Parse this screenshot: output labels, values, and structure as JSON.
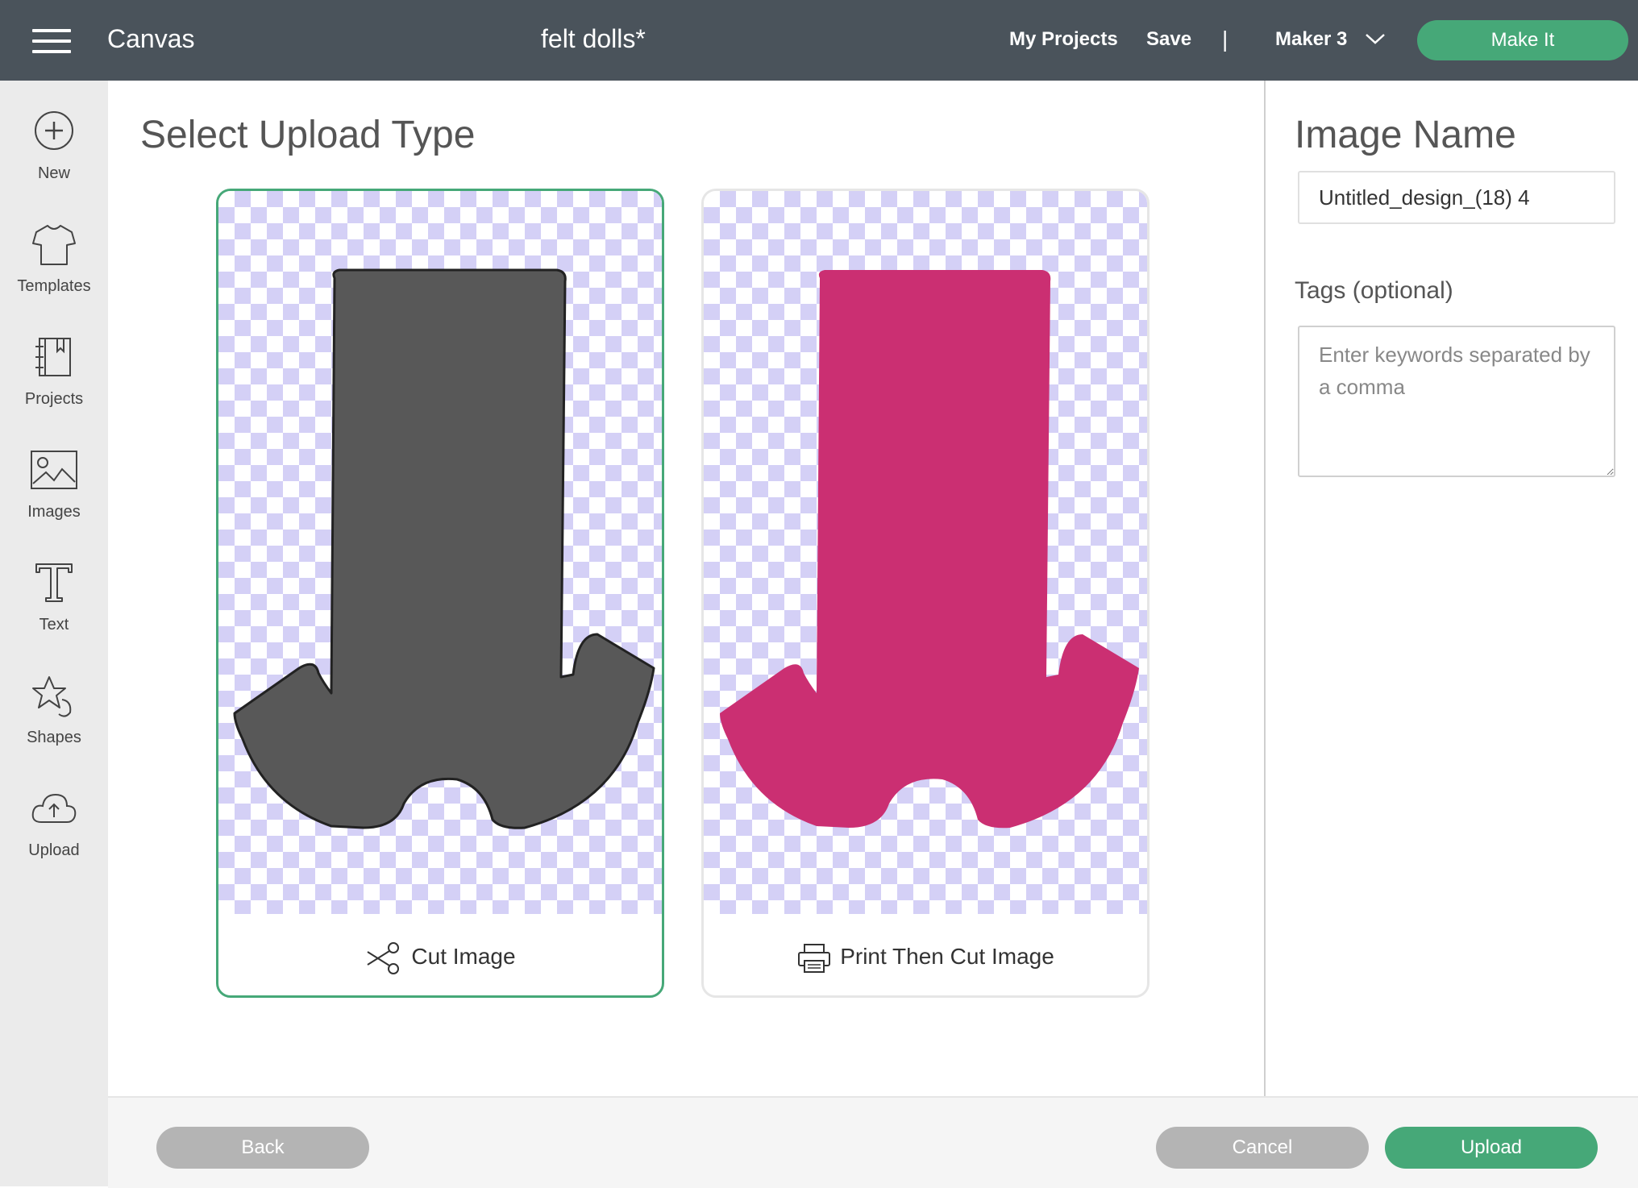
{
  "header": {
    "app_title": "Canvas",
    "project_title": "felt dolls*",
    "my_projects": "My Projects",
    "save": "Save",
    "separator": "|",
    "machine": "Maker 3",
    "make_it": "Make It"
  },
  "sidebar": {
    "items": [
      {
        "label": "New",
        "icon": "plus-circle-icon"
      },
      {
        "label": "Templates",
        "icon": "tshirt-icon"
      },
      {
        "label": "Projects",
        "icon": "notebook-icon"
      },
      {
        "label": "Images",
        "icon": "image-icon"
      },
      {
        "label": "Text",
        "icon": "text-t-icon"
      },
      {
        "label": "Shapes",
        "icon": "shapes-icon"
      },
      {
        "label": "Upload",
        "icon": "cloud-upload-icon"
      }
    ]
  },
  "main": {
    "title": "Select Upload Type",
    "options": [
      {
        "label": "Cut Image",
        "icon": "scissors-icon",
        "shape_color": "#585858",
        "selected": true
      },
      {
        "label": "Print Then Cut Image",
        "icon": "printer-icon",
        "shape_color": "#cb2f72",
        "selected": false
      }
    ]
  },
  "right_panel": {
    "title": "Image Name",
    "image_name_value": "Untitled_design_(18) 4",
    "tags_label": "Tags (optional)",
    "tags_placeholder": "Enter keywords separated by a comma"
  },
  "footer": {
    "back": "Back",
    "cancel": "Cancel",
    "upload": "Upload"
  },
  "colors": {
    "header_bg": "#4a535b",
    "accent_green": "#46a878",
    "disabled_gray": "#b4b4b4",
    "checker": "#d4d0f6"
  }
}
